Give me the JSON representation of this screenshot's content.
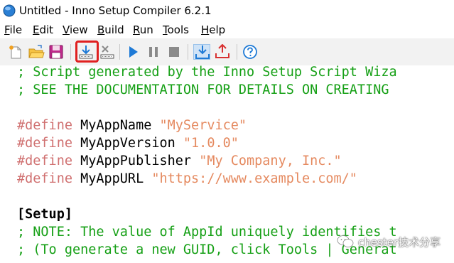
{
  "window": {
    "title": "Untitled - Inno Setup Compiler 6.2.1"
  },
  "menu": {
    "items": [
      {
        "label": "File",
        "underline": "F"
      },
      {
        "label": "Edit",
        "underline": "E"
      },
      {
        "label": "View",
        "underline": "V"
      },
      {
        "label": "Build",
        "underline": "B"
      },
      {
        "label": "Run",
        "underline": "R"
      },
      {
        "label": "Tools",
        "underline": "T"
      },
      {
        "label": "Help",
        "underline": "H"
      }
    ]
  },
  "toolbar": {
    "buttons": [
      {
        "icon": "new-file-icon"
      },
      {
        "icon": "open-folder-icon"
      },
      {
        "icon": "save-icon"
      },
      {
        "icon": "compile-icon",
        "highlighted": true
      },
      {
        "icon": "stop-compile-icon"
      },
      {
        "icon": "run-icon"
      },
      {
        "icon": "pause-icon"
      },
      {
        "icon": "terminate-icon"
      },
      {
        "icon": "target-compile-icon",
        "active": true
      },
      {
        "icon": "export-icon"
      },
      {
        "icon": "help-icon"
      }
    ],
    "colors": {
      "accent": "#1e7ad6",
      "highlight_border": "#e02020"
    }
  },
  "editor": {
    "colors": {
      "comment": "#16a016",
      "directive": "#d07070",
      "string": "#e58a60",
      "text": "#000000"
    },
    "lines": [
      {
        "comment": "; Script generated by the Inno Setup Script Wiza"
      },
      {
        "comment": "; SEE THE DOCUMENTATION FOR DETAILS ON CREATING"
      },
      {
        "blank": ""
      },
      {
        "directive": "#define",
        "name": " MyAppName ",
        "value": "\"MyService\""
      },
      {
        "directive": "#define",
        "name": " MyAppVersion ",
        "value": "\"1.0.0\""
      },
      {
        "directive": "#define",
        "name": " MyAppPublisher ",
        "value": "\"My Company, Inc.\""
      },
      {
        "directive": "#define",
        "name": " MyAppURL ",
        "value": "\"https://www.example.com/\""
      },
      {
        "blank": ""
      },
      {
        "section": "[Setup]"
      },
      {
        "comment": "; NOTE: The value of AppId uniquely identifies t"
      },
      {
        "comment": "; (To generate a new GUID, click Tools | Generat"
      }
    ]
  },
  "watermark": {
    "text": "chester技术分享"
  }
}
